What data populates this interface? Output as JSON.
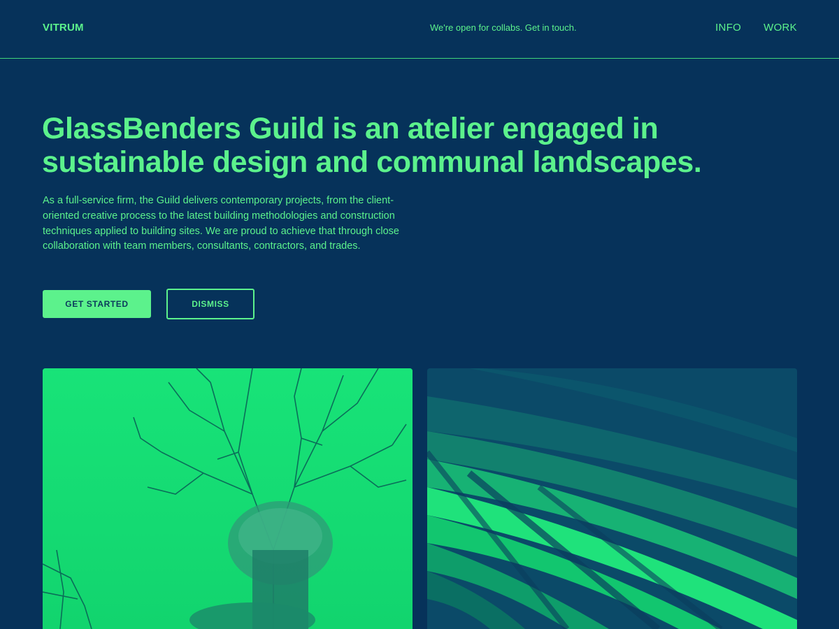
{
  "header": {
    "logo": "VITRUM",
    "tagline": "We're open for collabs. Get in touch.",
    "nav": [
      {
        "label": "INFO"
      },
      {
        "label": "WORK"
      }
    ]
  },
  "hero": {
    "title": "GlassBenders Guild is an atelier engaged in sustainable design and communal landscapes.",
    "body": "As a full-service firm, the Guild delivers contemporary projects, from the client-oriented creative process to the latest building methodologies and construction techniques applied to building sites. We are proud to achieve that through close collaboration with team members, consultants, contractors, and trades.",
    "primary_button": "GET STARTED",
    "secondary_button": "DISMISS"
  },
  "gallery": [
    {
      "subject": "supertree-structure-photo"
    },
    {
      "subject": "curved-steel-canopy-photo"
    }
  ],
  "colors": {
    "background": "#06325a",
    "accent": "#5cf28c",
    "button_text": "#0b3a5c"
  }
}
